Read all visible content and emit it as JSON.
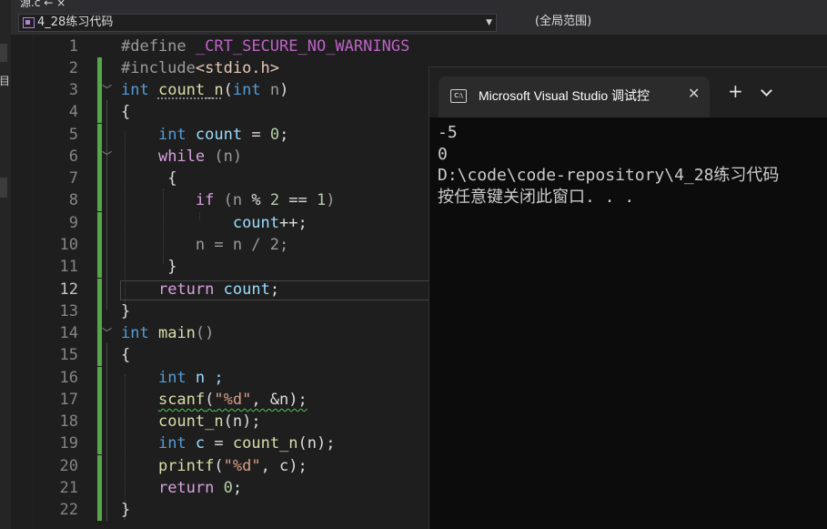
{
  "colors": {
    "added_bar": "#57a64a",
    "keyword": "#569cd6",
    "control": "#d8a0df",
    "function": "#dcdcaa",
    "string": "#d69d85",
    "number": "#b5cea8",
    "variable": "#9cdcfe"
  },
  "tab_strip": {
    "visible_text": "源.c ← ×"
  },
  "left_panel": {
    "partial_label": "目"
  },
  "navigation": {
    "file_combo": "4_28练习代码",
    "scope_combo": "(全局范围)"
  },
  "editor": {
    "current_line": 12,
    "line_numbers": [
      "1",
      "2",
      "3",
      "4",
      "5",
      "6",
      "7",
      "8",
      "9",
      "10",
      "11",
      "12",
      "13",
      "14",
      "15",
      "16",
      "17",
      "18",
      "19",
      "20",
      "21",
      "22"
    ]
  },
  "code": {
    "l1_directive": "#define",
    "l1_macro": "_CRT_SECURE_NO_WARNINGS",
    "l2_directive": "#include",
    "l2_header": "<stdio.h>",
    "l3_type": "int",
    "l3_func": "count_n",
    "l3_open": "(",
    "l3_ptype": "int",
    "l3_param": "n",
    "l3_close": ")",
    "l4_brace": "{",
    "l5_type": "int",
    "l5_var": "count",
    "l5_eq": " = ",
    "l5_num": "0",
    "l5_semi": ";",
    "l6_kw": "while",
    "l6_rest": " (n)",
    "l7_brace": "{",
    "l8_kw": "if",
    "l8_open": " (n ",
    "l8_op": "% ",
    "l8_num1": "2",
    "l8_mid": " == ",
    "l8_num2": "1",
    "l8_close": ")",
    "l9_var": "count",
    "l9_rest": "++;",
    "l10_code": "n = n / 2;",
    "l11_brace": "}",
    "l12_kw": "return",
    "l12_var": "count",
    "l12_semi": ";",
    "l13_brace": "}",
    "l14_type": "int",
    "l14_func": "main",
    "l14_parens": "()",
    "l15_brace": "{",
    "l16_type": "int",
    "l16_rest": "n ;",
    "l17_func": "scanf",
    "l17_open": "(",
    "l17_str": "\"%d\"",
    "l17_rest": ", &n);",
    "l18_func": "count_n",
    "l18_rest": "(n);",
    "l19_type": "int",
    "l19_var": "c",
    "l19_eq": " = ",
    "l19_func": "count_n",
    "l19_rest": "(n);",
    "l20_func": "printf",
    "l20_open": "(",
    "l20_str": "\"%d\"",
    "l20_rest": ", c);",
    "l21_kw": "return",
    "l21_num": "0",
    "l21_semi": ";",
    "l22_brace": "}"
  },
  "terminal": {
    "tab_icon_text": "C:\\",
    "tab_title": "Microsoft Visual Studio 调试控",
    "close_glyph": "✕",
    "new_tab_glyph": "+",
    "output_lines": [
      "-5",
      "0",
      "D:\\code\\code-repository\\4_28练习代码",
      "按任意键关闭此窗口. . ."
    ]
  }
}
